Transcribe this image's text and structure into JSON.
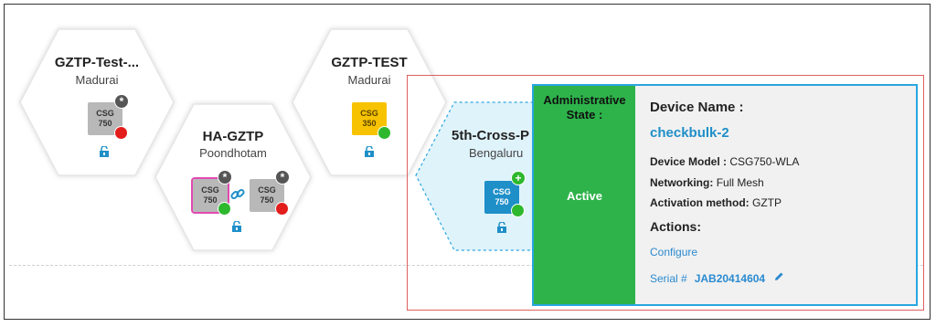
{
  "hexagons": [
    {
      "title": "GZTP-Test-...",
      "subtitle": "Madurai",
      "devices": [
        {
          "model": "CSG",
          "sub": "750",
          "color": "gray",
          "status": "red",
          "badge": "*"
        }
      ]
    },
    {
      "title": "HA-GZTP",
      "subtitle": "Poondhotam",
      "devices": [
        {
          "model": "CSG",
          "sub": "750",
          "color": "pink",
          "status": "green",
          "badge": "*"
        },
        {
          "model": "CSG",
          "sub": "750",
          "color": "gray",
          "status": "red",
          "badge": "*"
        }
      ]
    },
    {
      "title": "GZTP-TEST",
      "subtitle": "Madurai",
      "devices": [
        {
          "model": "CSG",
          "sub": "350",
          "color": "yellow",
          "status": "green"
        }
      ]
    },
    {
      "title": "5th-Cross-P",
      "subtitle": "Bengaluru",
      "devices": [
        {
          "model": "CSG",
          "sub": "750",
          "color": "blue",
          "status": "green",
          "badge": "+"
        }
      ]
    }
  ],
  "popup": {
    "state_label": "Administrative State :",
    "state_value": "Active",
    "device_name_label": "Device Name :",
    "device_name": "checkbulk-2",
    "model_label": "Device Model :",
    "model_value": "CSG750-WLA",
    "networking_label": "Networking:",
    "networking_value": "Full Mesh",
    "activation_label": "Activation method:",
    "activation_value": "GZTP",
    "actions_label": "Actions:",
    "configure_link": "Configure",
    "serial_label": "Serial #",
    "serial_value": "JAB20414604"
  },
  "colors": {
    "active_green": "#2db34a",
    "link_blue": "#2a8ad0",
    "selection_red": "#e06060",
    "popup_border": "#2aa6e0"
  },
  "icons": [
    "lock-open-icon",
    "link-icon",
    "pencil-icon",
    "status-dot-icon"
  ]
}
